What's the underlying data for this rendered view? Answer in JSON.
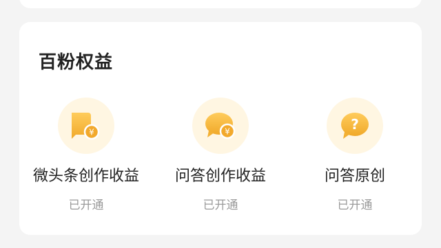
{
  "section": {
    "title": "百粉权益"
  },
  "items": [
    {
      "icon": "yuan-flag-icon",
      "label": "微头条创作收益",
      "status": "已开通"
    },
    {
      "icon": "yuan-chat-bubble-icon",
      "label": "问答创作收益",
      "status": "已开通"
    },
    {
      "icon": "question-bubble-icon",
      "label": "问答原创",
      "status": "已开通"
    }
  ],
  "colors": {
    "icon_gold": "#f5b93a",
    "icon_halo": "#fff6e2",
    "title_text": "#222222",
    "status_text": "#9a9a9a"
  }
}
